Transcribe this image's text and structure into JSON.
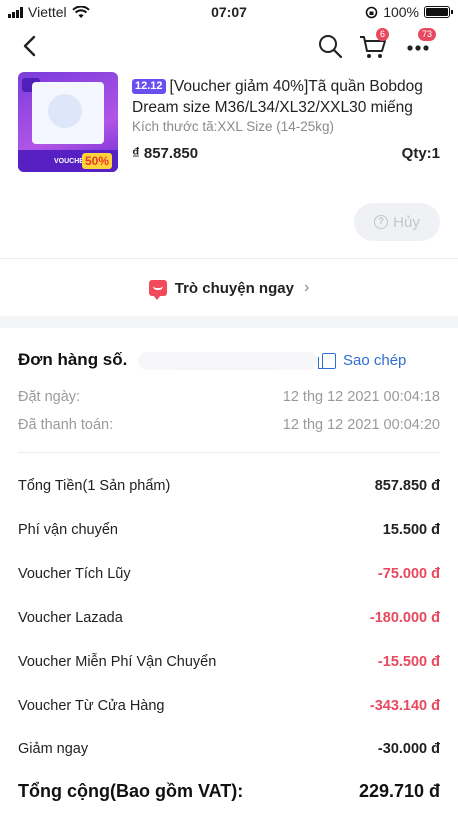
{
  "status_bar": {
    "carrier": "Viettel",
    "time": "07:07",
    "battery": "100%",
    "battery_level": 1.0
  },
  "nav": {
    "cart_badge": "6",
    "more_badge": "73"
  },
  "product": {
    "tag": "12.12",
    "title": "[Voucher giảm 40%]Tã quần Bobdog Dream size M36/L34/XL32/XXL30 miếng",
    "variant": "Kích thước tã:XXL Size (14-25kg)",
    "price": "₫ 857.850",
    "qty": "Qty:1",
    "thumb_label": "VOUCHER",
    "thumb_pct": "50%"
  },
  "actions": {
    "cancel_label": "Hủy"
  },
  "chat": {
    "label": "Trò chuyện ngay"
  },
  "order": {
    "heading": "Đơn hàng số. ",
    "copy_label": "Sao chép",
    "meta": [
      {
        "label": "Đặt ngày:",
        "value": "12 thg 12 2021   00:04:18"
      },
      {
        "label": "Đã thanh toán:",
        "value": "12 thg 12 2021   00:04:20"
      }
    ]
  },
  "summary": [
    {
      "label": "Tổng Tiền(1 Sản phẩm)",
      "value": "857.850 đ",
      "negative": false
    },
    {
      "label": "Phí vận chuyển",
      "value": "15.500 đ",
      "negative": false
    },
    {
      "label": "Voucher Tích Lũy",
      "value": "-75.000 đ",
      "negative": true
    },
    {
      "label": "Voucher Lazada",
      "value": "-180.000 đ",
      "negative": true
    },
    {
      "label": "Voucher Miễn Phí Vận Chuyển",
      "value": "-15.500 đ",
      "negative": true
    },
    {
      "label": "Voucher Từ Cửa Hàng",
      "value": "-343.140 đ",
      "negative": true
    },
    {
      "label": "Giảm ngay",
      "value": "-30.000 đ",
      "negative": false
    }
  ],
  "total": {
    "label": "Tổng cộng(Bao gồm VAT):",
    "value": "229.710 đ"
  },
  "colors": {
    "accent_red": "#e8495f",
    "link_blue": "#2f6fd4",
    "tag_purple": "#6a4ff0"
  }
}
